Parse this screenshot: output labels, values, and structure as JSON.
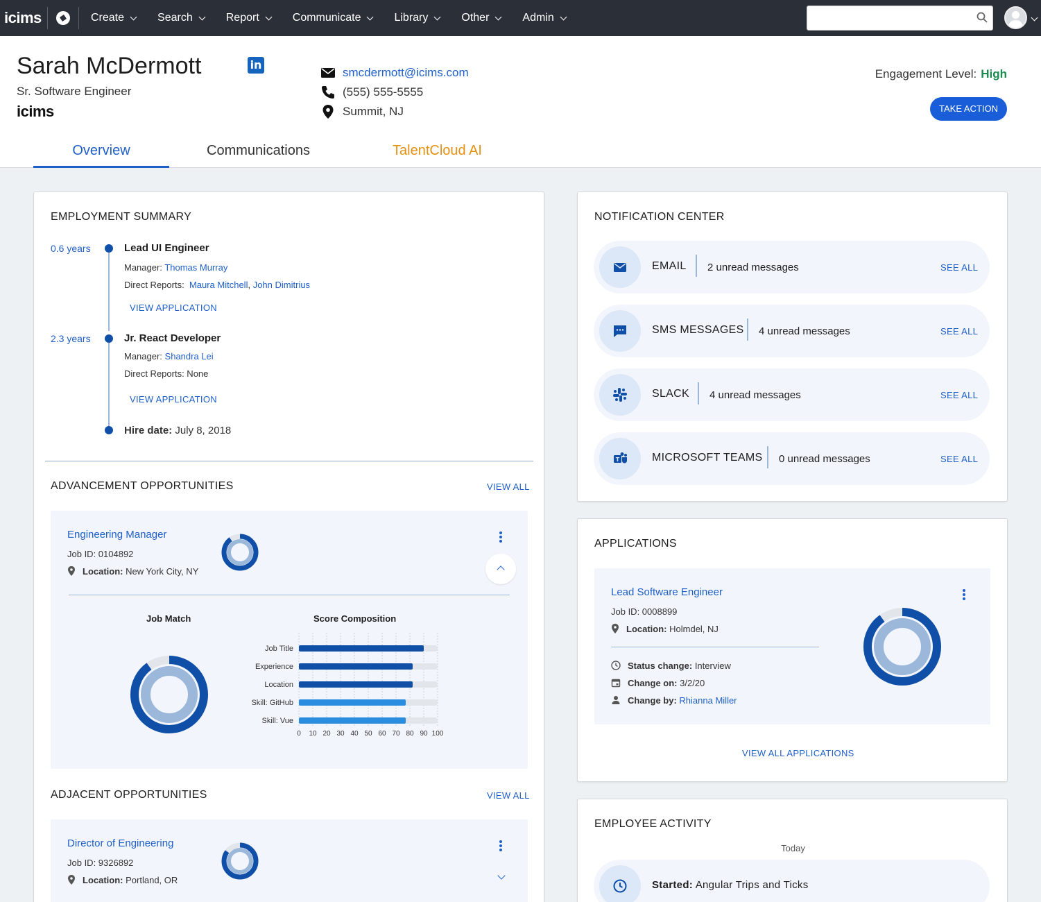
{
  "nav": {
    "logo": "icims",
    "items": [
      "Create",
      "Search",
      "Report",
      "Communicate",
      "Library",
      "Other",
      "Admin"
    ],
    "search_placeholder": ""
  },
  "profile": {
    "name": "Sarah McDermott",
    "title": "Sr. Software Engineer",
    "company_logo": "icims",
    "email": "smcdermott@icims.com",
    "phone": "(555) 555-5555",
    "location": "Summit, NJ",
    "engagement_label": "Engagement Level:",
    "engagement_value": "High",
    "take_action": "TAKE ACTION"
  },
  "tabs": [
    {
      "label": "Overview",
      "active": true
    },
    {
      "label": "Communications",
      "active": false
    },
    {
      "label": "TalentCloud AI",
      "active": false
    }
  ],
  "employment": {
    "title": "EMPLOYMENT SUMMARY",
    "entries": [
      {
        "years": "0.6 years",
        "role": "Lead UI Engineer",
        "manager_label": "Manager:",
        "manager": "Thomas Murray",
        "reports_label": "Direct Reports:",
        "reports": [
          "Maura Mitchell",
          "John Dimitrius"
        ],
        "view": "VIEW APPLICATION"
      },
      {
        "years": "2.3 years",
        "role": "Jr. React Developer",
        "manager_label": "Manager:",
        "manager": "Shandra Lei",
        "reports_label": "Direct Reports: None",
        "view": "VIEW APPLICATION"
      }
    ],
    "hire_label": "Hire date:",
    "hire_date": "July 8, 2018"
  },
  "advancement": {
    "title": "ADVANCEMENT OPPORTUNITIES",
    "view_all": "VIEW ALL",
    "job": {
      "title": "Engineering Manager",
      "job_id": "Job ID: 0104892",
      "location_label": "Location:",
      "location": "New York City, NY",
      "match": 0.9
    },
    "job_match_label": "Job Match",
    "score_label": "Score Composition"
  },
  "chart_data": {
    "type": "bar",
    "orientation": "horizontal",
    "categories": [
      "Job Title",
      "Experience",
      "Location",
      "Skill: GitHub",
      "Skill: Vue"
    ],
    "values": [
      90,
      82,
      82,
      77,
      77
    ],
    "max": 100,
    "xticks": [
      0,
      10,
      20,
      30,
      40,
      50,
      60,
      70,
      80,
      90,
      100
    ],
    "colors": [
      "#0f4fa8",
      "#0f4fa8",
      "#0f4fa8",
      "#2b8de0",
      "#2b8de0"
    ],
    "grid": true
  },
  "adjacent": {
    "title": "ADJACENT OPPORTUNITIES",
    "view_all": "VIEW ALL",
    "job": {
      "title": "Director of Engineering",
      "job_id": "Job ID: 9326892",
      "location_label": "Location:",
      "location": "Portland, OR",
      "match": 0.85
    }
  },
  "notifications": {
    "title": "NOTIFICATION CENTER",
    "items": [
      {
        "name": "EMAIL",
        "count": "2 unread messages",
        "see": "SEE ALL",
        "icon": "mail-icon"
      },
      {
        "name": "SMS MESSAGES",
        "count": "4 unread messages",
        "see": "SEE ALL",
        "icon": "sms-icon"
      },
      {
        "name": "SLACK",
        "count": "4 unread messages",
        "see": "SEE ALL",
        "icon": "slack-icon"
      },
      {
        "name": "MICROSOFT TEAMS",
        "count": "0 unread messages",
        "see": "SEE ALL",
        "icon": "teams-icon"
      }
    ]
  },
  "applications": {
    "title": "APPLICATIONS",
    "job": {
      "title": "Lead Software Engineer",
      "job_id": "Job ID: 0008899",
      "location_label": "Location:",
      "location": "Holmdel, NJ",
      "match": 0.9
    },
    "status_label": "Status change:",
    "status": "Interview",
    "change_on_label": "Change on:",
    "change_on": "3/2/20",
    "change_by_label": "Change by:",
    "change_by": "Rhianna Miller",
    "view_all": "VIEW ALL APPLICATIONS"
  },
  "activity": {
    "title": "EMPLOYEE ACTIVITY",
    "day": "Today",
    "item_label": "Started:",
    "item_value": "Angular Trips and Ticks"
  }
}
